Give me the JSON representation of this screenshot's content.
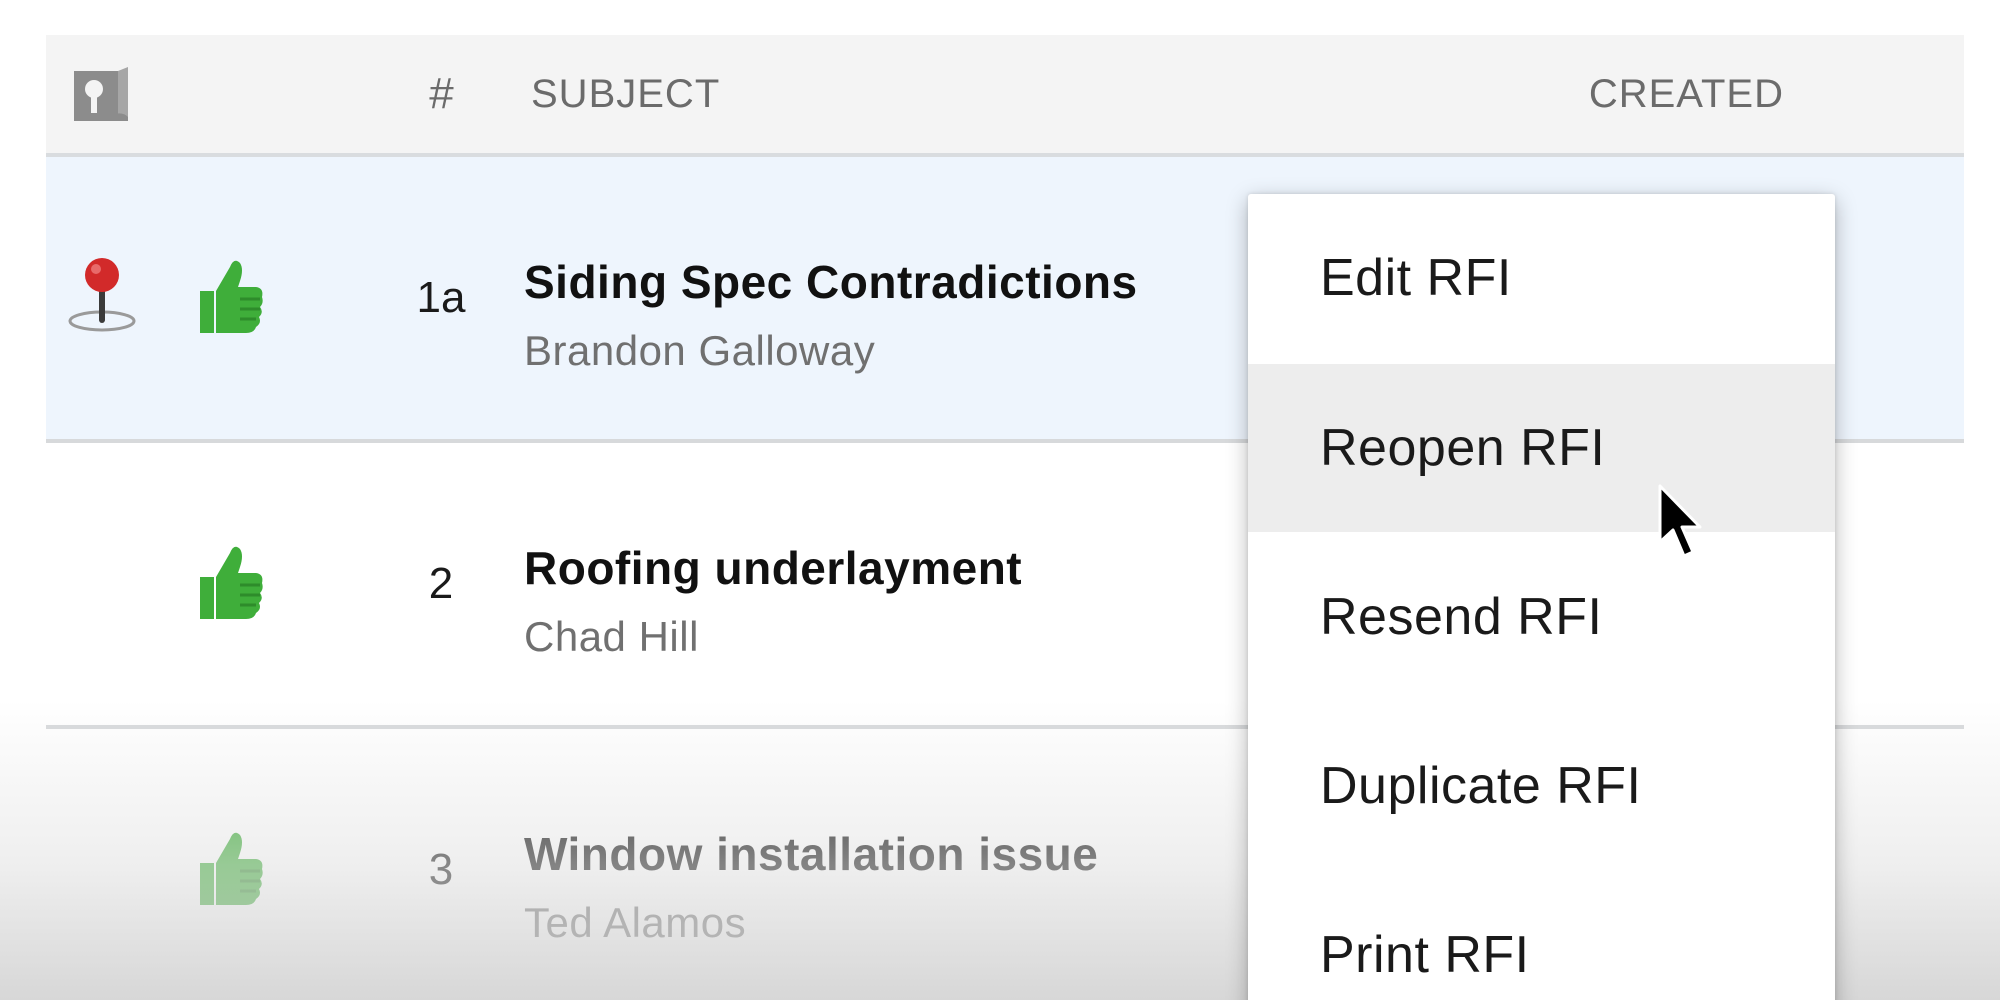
{
  "table": {
    "columns": {
      "number": "#",
      "subject": "SUBJECT",
      "created": "CREATED"
    },
    "header_icon": "plans-sheet-icon",
    "rows": [
      {
        "number": "1a",
        "subject": "Siding Spec Contradictions",
        "author": "Brandon Galloway",
        "status_icon": "thumbs-up-icon",
        "location_pin": true,
        "selected": true
      },
      {
        "number": "2",
        "subject": "Roofing underlayment",
        "author": "Chad Hill",
        "status_icon": "thumbs-up-icon",
        "location_pin": false,
        "selected": false
      },
      {
        "number": "3",
        "subject": "Window installation issue",
        "author": "Ted Alamos",
        "status_icon": "thumbs-up-icon",
        "location_pin": false,
        "selected": false
      }
    ]
  },
  "context_menu": {
    "items": [
      {
        "label": "Edit RFI"
      },
      {
        "label": "Reopen RFI",
        "hovered": true
      },
      {
        "label": "Resend RFI"
      },
      {
        "label": "Duplicate RFI"
      },
      {
        "label": "Print RFI"
      }
    ]
  },
  "colors": {
    "selected_row": "#eef5fd",
    "thumbs_up": "#3fae3a",
    "pin_head": "#d22a2a",
    "header_bg": "#f4f4f4",
    "menu_hover": "#ededed"
  }
}
